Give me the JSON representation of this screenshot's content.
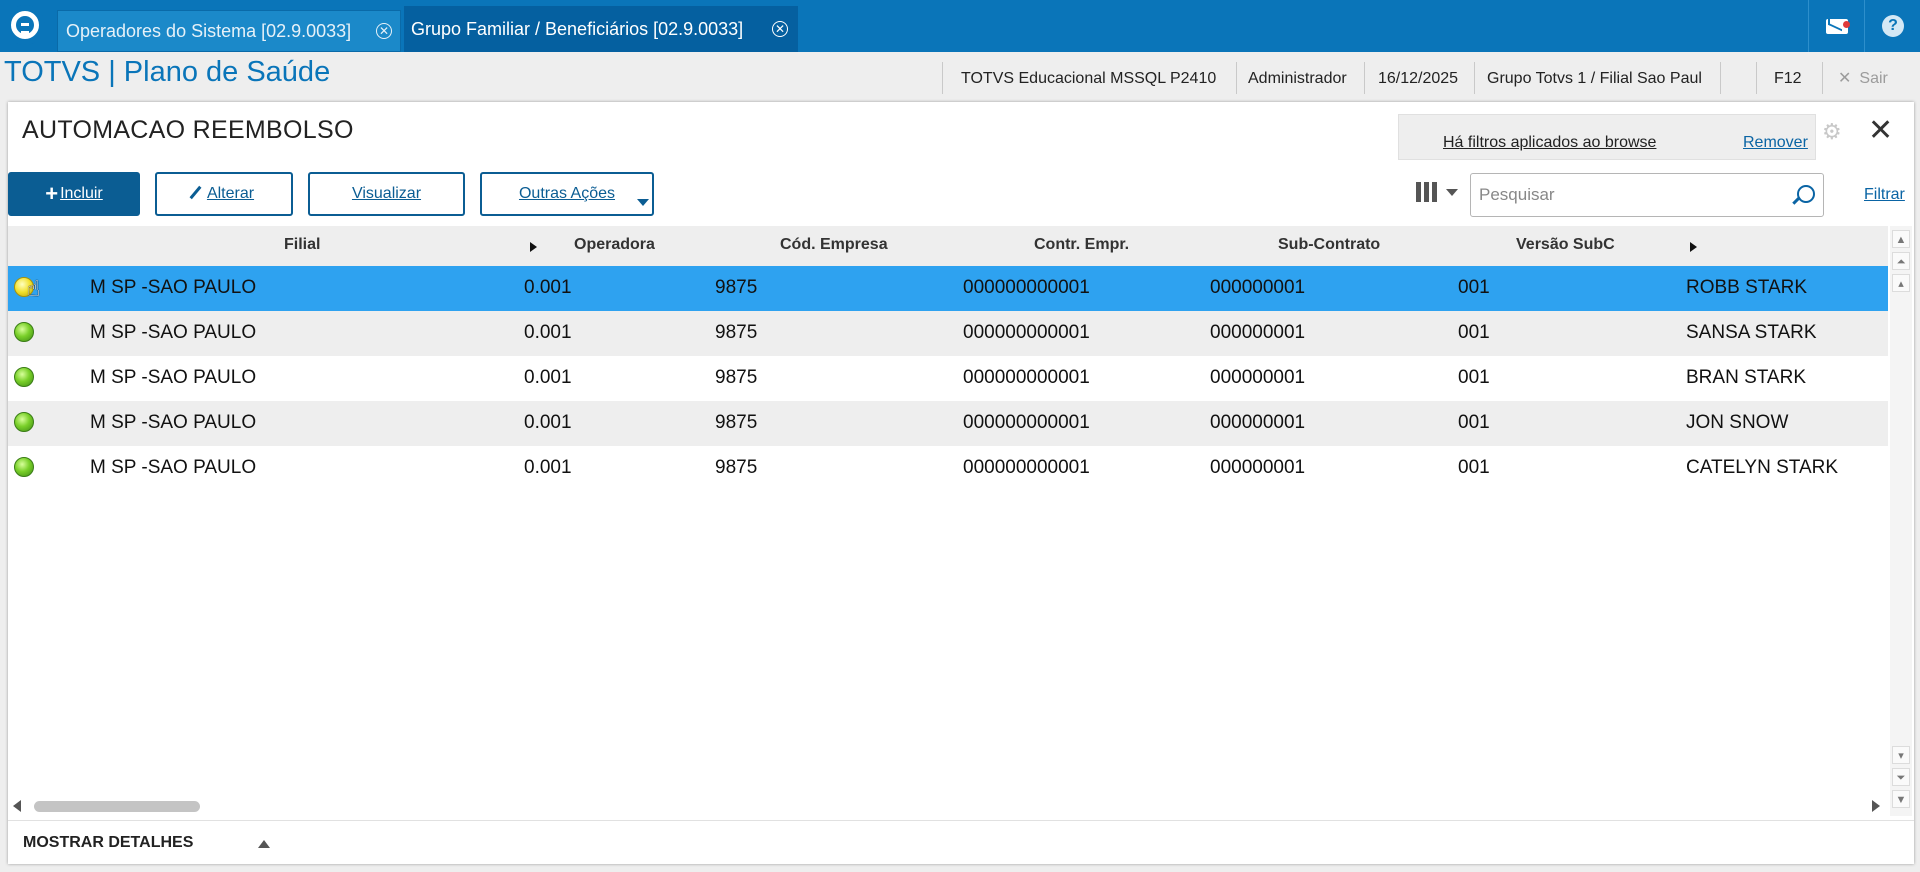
{
  "tabs": [
    {
      "label": "Operadores do Sistema [02.9.0033]",
      "active": false
    },
    {
      "label": "Grupo Familiar / Beneficiários [02.9.0033]",
      "active": true
    }
  ],
  "topbar": {
    "mail_icon": "mail-icon",
    "help_icon": "help-icon"
  },
  "header": {
    "app_title": "TOTVS | Plano de Saúde",
    "environment": "TOTVS Educacional MSSQL P2410",
    "user": "Administrador",
    "date": "16/12/2025",
    "branch": "Grupo Totvs 1 / Filial Sao Paul",
    "shortcut": "F12",
    "exit_label": "Sair"
  },
  "browse": {
    "title": "AUTOMACAO REEMBOLSO",
    "filter_notice": "Há filtros aplicados ao browse",
    "filter_remove": "Remover",
    "search_placeholder": "Pesquisar",
    "filter_link": "Filtrar"
  },
  "actions": {
    "incluir": "Incluir",
    "alterar": "Alterar",
    "visualizar": "Visualizar",
    "outras": "Outras Ações"
  },
  "grid": {
    "columns": [
      "Filial",
      "Operadora",
      "Cód. Empresa",
      "Contr. Empr.",
      "Sub-Contrato",
      "Versão SubC"
    ],
    "rows": [
      {
        "status": "yellow",
        "filial": "M SP -SAO PAULO",
        "operadora": "0.001",
        "cod_empresa": "9875",
        "contr_empr": "000000000001",
        "sub_contrato": "000000001",
        "versao_subc": "001",
        "nome": "ROBB STARK"
      },
      {
        "status": "green",
        "filial": "M SP -SAO PAULO",
        "operadora": "0.001",
        "cod_empresa": "9875",
        "contr_empr": "000000000001",
        "sub_contrato": "000000001",
        "versao_subc": "001",
        "nome": "SANSA STARK"
      },
      {
        "status": "green",
        "filial": "M SP -SAO PAULO",
        "operadora": "0.001",
        "cod_empresa": "9875",
        "contr_empr": "000000000001",
        "sub_contrato": "000000001",
        "versao_subc": "001",
        "nome": "BRAN STARK"
      },
      {
        "status": "green",
        "filial": "M SP -SAO PAULO",
        "operadora": "0.001",
        "cod_empresa": "9875",
        "contr_empr": "000000000001",
        "sub_contrato": "000000001",
        "versao_subc": "001",
        "nome": "JON SNOW"
      },
      {
        "status": "green",
        "filial": "M SP -SAO PAULO",
        "operadora": "0.001",
        "cod_empresa": "9875",
        "contr_empr": "000000000001",
        "sub_contrato": "000000001",
        "versao_subc": "001",
        "nome": "CATELYN STARK"
      }
    ],
    "selected_row": 0
  },
  "details": {
    "label": "MOSTRAR DETALHES"
  },
  "colors": {
    "brand": "#0a75b9",
    "primary_button": "#0b5d93",
    "selected_row": "#2ea2f0"
  }
}
